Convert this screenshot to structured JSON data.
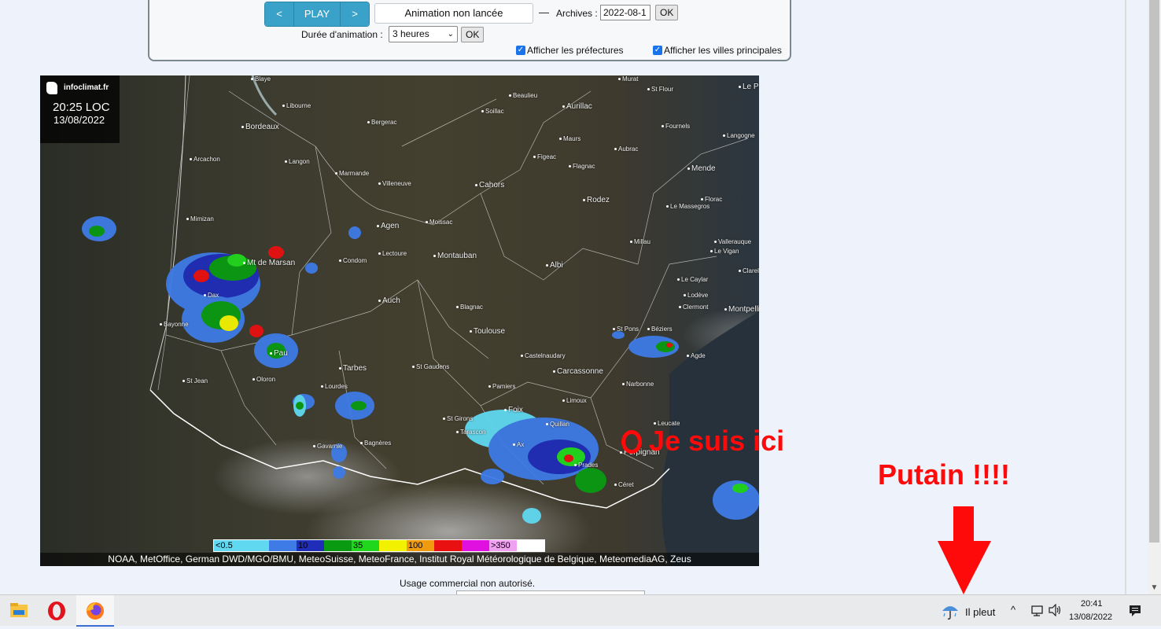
{
  "controls": {
    "prev_label": "<",
    "play_label": "PLAY",
    "next_label": ">",
    "animation_status": "Animation non lancée",
    "dash": "—",
    "archives_label": "Archives :",
    "archives_value": "2022-08-1",
    "ok_label": "OK",
    "duration_label": "Durée d'animation :",
    "duration_value": "3 heures",
    "show_prefectures_label": "Afficher les préfectures",
    "show_prefectures_checked": true,
    "show_cities_label": "Afficher les villes principales",
    "show_cities_checked": true
  },
  "map": {
    "logo_text": "infoclimat.fr",
    "time": "20:25 LOC",
    "date": "13/08/2022",
    "cities": [
      {
        "name": "Blaye"
      },
      {
        "name": "Libourne"
      },
      {
        "name": "Bordeaux",
        "big": true
      },
      {
        "name": "Arcachon"
      },
      {
        "name": "Langon"
      },
      {
        "name": "Mimizan"
      },
      {
        "name": "Mt de Marsan",
        "big": true
      },
      {
        "name": "Dax"
      },
      {
        "name": "Bayonne"
      },
      {
        "name": "Pau",
        "big": true
      },
      {
        "name": "Oloron"
      },
      {
        "name": "St Jean"
      },
      {
        "name": "Lourdes"
      },
      {
        "name": "Tarbes",
        "big": true
      },
      {
        "name": "Gavarnie"
      },
      {
        "name": "Bagnères"
      },
      {
        "name": "Condom"
      },
      {
        "name": "Lectoure"
      },
      {
        "name": "Agen",
        "big": true
      },
      {
        "name": "Marmande"
      },
      {
        "name": "Villeneuve"
      },
      {
        "name": "Bergerac"
      },
      {
        "name": "Soillac"
      },
      {
        "name": "Beaulieu"
      },
      {
        "name": "Aurillac",
        "big": true
      },
      {
        "name": "Murat"
      },
      {
        "name": "St Flour"
      },
      {
        "name": "Le Puy",
        "big": true
      },
      {
        "name": "Fournels"
      },
      {
        "name": "Langogne"
      },
      {
        "name": "Mende",
        "big": true
      },
      {
        "name": "Florac"
      },
      {
        "name": "Le Massegros"
      },
      {
        "name": "Millau"
      },
      {
        "name": "Vallerauque"
      },
      {
        "name": "Le Vigan"
      },
      {
        "name": "Clarel"
      },
      {
        "name": "Le Caylar"
      },
      {
        "name": "Lodève"
      },
      {
        "name": "Clermont"
      },
      {
        "name": "Montpellier",
        "big": true
      },
      {
        "name": "Béziers"
      },
      {
        "name": "Agde"
      },
      {
        "name": "St Pons"
      },
      {
        "name": "Narbonne"
      },
      {
        "name": "Leucate"
      },
      {
        "name": "Perpignan",
        "big": true
      },
      {
        "name": "Céret"
      },
      {
        "name": "Prades"
      },
      {
        "name": "Ax"
      },
      {
        "name": "Quillan"
      },
      {
        "name": "Limoux"
      },
      {
        "name": "Carcassonne",
        "big": true
      },
      {
        "name": "Castelnaudary"
      },
      {
        "name": "Foix",
        "big": true
      },
      {
        "name": "Pamiers"
      },
      {
        "name": "St Girons"
      },
      {
        "name": "Tarascon"
      },
      {
        "name": "St Gaudens"
      },
      {
        "name": "Auch",
        "big": true
      },
      {
        "name": "Toulouse",
        "big": true
      },
      {
        "name": "Blagnac"
      },
      {
        "name": "Montauban",
        "big": true
      },
      {
        "name": "Moissac"
      },
      {
        "name": "Albi",
        "big": true
      },
      {
        "name": "Cahors",
        "big": true
      },
      {
        "name": "Figeac"
      },
      {
        "name": "Maurs"
      },
      {
        "name": "Flagnac"
      },
      {
        "name": "Aubrac"
      },
      {
        "name": "Rodez",
        "big": true
      }
    ],
    "legend": [
      {
        "label": "<0.5",
        "color": "#5fd8f0"
      },
      {
        "label": "",
        "color": "#5fd8f0"
      },
      {
        "label": "",
        "color": "#3e7be6"
      },
      {
        "label": "10",
        "color": "#1f2db8"
      },
      {
        "label": "",
        "color": "#0a9a12"
      },
      {
        "label": "35",
        "color": "#21d71d"
      },
      {
        "label": "",
        "color": "#f2f200"
      },
      {
        "label": "100",
        "color": "#f09a10"
      },
      {
        "label": "",
        "color": "#e81010"
      },
      {
        "label": "",
        "color": "#e010e0"
      },
      {
        "label": ">350",
        "color": "#f0a0f0"
      },
      {
        "label": "",
        "color": "#ffffff"
      }
    ],
    "credits": "NOAA, MetOffice, German DWD/MGO/BMU, MeteoSuisse, MeteoFrance, Institut Royal Météorologique de Belgique, MeteomediaAG, Zeus"
  },
  "annotations": {
    "here_text": "Je suis ici",
    "exclaim_text": "Putain !!!!",
    "color": "#ff0a0a"
  },
  "usage_note": "Usage commercial non autorisé.",
  "taskbar": {
    "apps": [
      "file-explorer-icon",
      "opera-icon",
      "firefox-icon"
    ],
    "weather_text": "Il pleut",
    "clock_time": "20:41",
    "clock_date": "13/08/2022"
  }
}
